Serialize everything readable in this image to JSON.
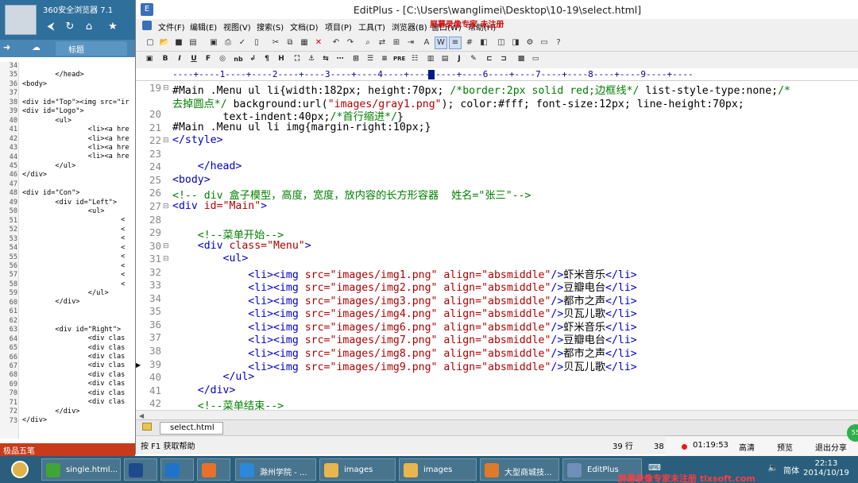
{
  "bg_browser": {
    "title": "360安全浏览器 7.1",
    "tab": "标题",
    "lines": [
      {
        "n": "34",
        "t": ""
      },
      {
        "n": "35",
        "t": "        </head>"
      },
      {
        "n": "36",
        "t": "<body>"
      },
      {
        "n": "37",
        "t": ""
      },
      {
        "n": "38",
        "t": "<div id=\"Top\"><img src=\"ir"
      },
      {
        "n": "39",
        "t": "<div id=\"Logo\">"
      },
      {
        "n": "40",
        "t": "        <ul>"
      },
      {
        "n": "41",
        "t": "                <li><a hre"
      },
      {
        "n": "42",
        "t": "                <li><a hre"
      },
      {
        "n": "43",
        "t": "                <li><a hre"
      },
      {
        "n": "44",
        "t": "                <li><a hre"
      },
      {
        "n": "45",
        "t": "        </ul>"
      },
      {
        "n": "46",
        "t": "</div>"
      },
      {
        "n": "47",
        "t": ""
      },
      {
        "n": "48",
        "t": "<div id=\"Con\">"
      },
      {
        "n": "49",
        "t": "        <div id=\"Left\">"
      },
      {
        "n": "50",
        "t": "                <ul>"
      },
      {
        "n": "51",
        "t": "                        <"
      },
      {
        "n": "52",
        "t": "                        <"
      },
      {
        "n": "53",
        "t": "                        <"
      },
      {
        "n": "54",
        "t": "                        <"
      },
      {
        "n": "55",
        "t": "                        <"
      },
      {
        "n": "56",
        "t": "                        <"
      },
      {
        "n": "57",
        "t": "                        <"
      },
      {
        "n": "58",
        "t": "                        <"
      },
      {
        "n": "59",
        "t": "                </ul>"
      },
      {
        "n": "60",
        "t": "        </div>"
      },
      {
        "n": "61",
        "t": ""
      },
      {
        "n": "62",
        "t": ""
      },
      {
        "n": "63",
        "t": "        <div id=\"Right\">"
      },
      {
        "n": "64",
        "t": "                <div clas"
      },
      {
        "n": "65",
        "t": "                <div clas"
      },
      {
        "n": "66",
        "t": "                <div clas"
      },
      {
        "n": "67",
        "t": "                <div clas"
      },
      {
        "n": "68",
        "t": "                <div clas"
      },
      {
        "n": "69",
        "t": "                <div clas"
      },
      {
        "n": "70",
        "t": "                <div clas"
      },
      {
        "n": "71",
        "t": "                <div clas"
      },
      {
        "n": "72",
        "t": "        </div>"
      },
      {
        "n": "73",
        "t": "</div>"
      }
    ]
  },
  "window": {
    "title": "EditPlus - [C:\\Users\\wanglimei\\Desktop\\10-19\\select.html]",
    "watermark": "屏幕录像专家 未注册"
  },
  "menu": [
    "文件(F)",
    "编辑(E)",
    "视图(V)",
    "搜索(S)",
    "文档(D)",
    "项目(P)",
    "工具(T)",
    "浏览器(B)",
    "窗口(W)",
    "帮助(H)"
  ],
  "ruler": "----+----1----+----2----+----3----+----4----+----5----+----6----+----7----+----8----+----9----+----",
  "editor_lines": [
    {
      "n": "19",
      "fold": "⊟",
      "parts": [
        [
          "sel",
          "#Main .Menu ul li{width:182px; height:70px; "
        ],
        [
          "com",
          "/*border:2px solid red;边框线*/"
        ],
        [
          "sel",
          " list-style-type:none;"
        ],
        [
          "com",
          "/*"
        ]
      ]
    },
    {
      "n": "",
      "fold": "",
      "parts": [
        [
          "com",
          "去掉圆点*/"
        ],
        [
          "sel",
          " background:url("
        ],
        [
          "str",
          "\"images/gray1.png\""
        ],
        [
          "sel",
          "); color:#fff; font-size:12px; line-height:70px;"
        ]
      ]
    },
    {
      "n": "20",
      "fold": "",
      "parts": [
        [
          "sel",
          "        text-indent:40px;"
        ],
        [
          "com",
          "/*首行缩进*/"
        ],
        [
          "sel",
          "}"
        ]
      ]
    },
    {
      "n": "21",
      "fold": "",
      "parts": [
        [
          "sel",
          "#Main .Menu ul li img{margin-right:10px;}"
        ]
      ]
    },
    {
      "n": "22",
      "fold": "⊟",
      "parts": [
        [
          "tag",
          "</style>"
        ]
      ]
    },
    {
      "n": "23",
      "fold": "",
      "parts": [
        [
          "sel",
          ""
        ]
      ]
    },
    {
      "n": "24",
      "fold": "",
      "parts": [
        [
          "tag",
          "    </head>"
        ]
      ]
    },
    {
      "n": "25",
      "fold": "",
      "parts": [
        [
          "tag",
          "<body>"
        ]
      ]
    },
    {
      "n": "26",
      "fold": "",
      "parts": [
        [
          "com",
          "<!-- div 盒子模型，高度，宽度，放内容的长方形容器  姓名=\"张三\"-->"
        ]
      ]
    },
    {
      "n": "27",
      "fold": "⊟",
      "parts": [
        [
          "tag",
          "<div "
        ],
        [
          "attr",
          "id="
        ],
        [
          "str",
          "\"Main\""
        ],
        [
          "tag",
          ">"
        ]
      ]
    },
    {
      "n": "28",
      "fold": "",
      "parts": [
        [
          "sel",
          ""
        ]
      ]
    },
    {
      "n": "29",
      "fold": "",
      "parts": [
        [
          "com",
          "    <!--菜单开始-->"
        ]
      ]
    },
    {
      "n": "30",
      "fold": "⊟",
      "parts": [
        [
          "tag",
          "    <div "
        ],
        [
          "attr",
          "class="
        ],
        [
          "str",
          "\"Menu\""
        ],
        [
          "tag",
          ">"
        ]
      ]
    },
    {
      "n": "31",
      "fold": "⊟",
      "parts": [
        [
          "tag",
          "        <ul>"
        ]
      ]
    },
    {
      "n": "32",
      "fold": "",
      "parts": [
        [
          "tag",
          "            <li><img "
        ],
        [
          "attr",
          "src="
        ],
        [
          "str",
          "\"images/img1.png\""
        ],
        [
          "attr",
          " align="
        ],
        [
          "str",
          "\"absmiddle\""
        ],
        [
          "tag",
          "/>"
        ],
        [
          "sel",
          "虾米音乐"
        ],
        [
          "tag",
          "</li>"
        ]
      ]
    },
    {
      "n": "33",
      "fold": "",
      "parts": [
        [
          "tag",
          "            <li><img "
        ],
        [
          "attr",
          "src="
        ],
        [
          "str",
          "\"images/img2.png\""
        ],
        [
          "attr",
          " align="
        ],
        [
          "str",
          "\"absmiddle\""
        ],
        [
          "tag",
          "/>"
        ],
        [
          "sel",
          "豆瓣电台"
        ],
        [
          "tag",
          "</li>"
        ]
      ]
    },
    {
      "n": "34",
      "fold": "",
      "parts": [
        [
          "tag",
          "            <li><img "
        ],
        [
          "attr",
          "src="
        ],
        [
          "str",
          "\"images/img3.png\""
        ],
        [
          "attr",
          " align="
        ],
        [
          "str",
          "\"absmiddle\""
        ],
        [
          "tag",
          "/>"
        ],
        [
          "sel",
          "都市之声"
        ],
        [
          "tag",
          "</li>"
        ]
      ]
    },
    {
      "n": "35",
      "fold": "",
      "parts": [
        [
          "tag",
          "            <li><img "
        ],
        [
          "attr",
          "src="
        ],
        [
          "str",
          "\"images/img4.png\""
        ],
        [
          "attr",
          " align="
        ],
        [
          "str",
          "\"absmiddle\""
        ],
        [
          "tag",
          "/>"
        ],
        [
          "sel",
          "贝瓦儿歌"
        ],
        [
          "tag",
          "</li>"
        ]
      ]
    },
    {
      "n": "36",
      "fold": "",
      "parts": [
        [
          "tag",
          "            <li><img "
        ],
        [
          "attr",
          "src="
        ],
        [
          "str",
          "\"images/img6.png\""
        ],
        [
          "attr",
          " align="
        ],
        [
          "str",
          "\"absmiddle\""
        ],
        [
          "tag",
          "/>"
        ],
        [
          "sel",
          "虾米音乐"
        ],
        [
          "tag",
          "</li>"
        ]
      ]
    },
    {
      "n": "37",
      "fold": "",
      "parts": [
        [
          "tag",
          "            <li><img "
        ],
        [
          "attr",
          "src="
        ],
        [
          "str",
          "\"images/img7.png\""
        ],
        [
          "attr",
          " align="
        ],
        [
          "str",
          "\"absmiddle\""
        ],
        [
          "tag",
          "/>"
        ],
        [
          "sel",
          "豆瓣电台"
        ],
        [
          "tag",
          "</li>"
        ]
      ]
    },
    {
      "n": "38",
      "fold": "",
      "parts": [
        [
          "tag",
          "            <li><img "
        ],
        [
          "attr",
          "src="
        ],
        [
          "str",
          "\"images/img8.png\""
        ],
        [
          "attr",
          " align="
        ],
        [
          "str",
          "\"absmiddle\""
        ],
        [
          "tag",
          "/>"
        ],
        [
          "sel",
          "都市之声"
        ],
        [
          "tag",
          "</li>"
        ]
      ]
    },
    {
      "n": "39",
      "fold": "",
      "parts": [
        [
          "tag",
          "            <li><img "
        ],
        [
          "attr",
          "src="
        ],
        [
          "str",
          "\"images/img9.png\""
        ],
        [
          "attr",
          " align="
        ],
        [
          "str",
          "\"absmiddle\""
        ],
        [
          "tag",
          "/>"
        ],
        [
          "sel",
          "贝瓦儿歌"
        ],
        [
          "tag",
          "</li>"
        ]
      ]
    },
    {
      "n": "40",
      "fold": "",
      "parts": [
        [
          "tag",
          "        </ul>"
        ]
      ]
    },
    {
      "n": "41",
      "fold": "",
      "parts": [
        [
          "tag",
          "    </div>"
        ]
      ]
    },
    {
      "n": "42",
      "fold": "",
      "parts": [
        [
          "com",
          "    <!--菜单结束-->"
        ]
      ]
    }
  ],
  "doc_tab": "select.html",
  "status": {
    "help": "按 F1 获取帮助",
    "line": "39 行",
    "col": "38 列"
  },
  "recorder": {
    "time": "01:19:53",
    "hd": "高清",
    "preview": "预览",
    "exit_share": "退出分享",
    "green": "55"
  },
  "ime": "极品五笔",
  "taskbar": [
    {
      "label": "single.html...",
      "color": "#3fa635"
    },
    {
      "label": "",
      "color": "#1d4a8c"
    },
    {
      "label": "",
      "color": "#1f74c9"
    },
    {
      "label": "",
      "color": "#e8702a"
    },
    {
      "label": "滁州学院 - ...",
      "color": "#2c88d8"
    },
    {
      "label": "images",
      "color": "#e8b64c"
    },
    {
      "label": "images",
      "color": "#e8b64c"
    },
    {
      "label": "大型商城技...",
      "color": "#e07a2a"
    },
    {
      "label": "EditPlus",
      "color": "#6f8fb8"
    }
  ],
  "tray_lang": "简体",
  "clock": {
    "time": "22:13",
    "date": "2014/10/19"
  },
  "watermark_bottom": "屏幕录像专家未注册 tlxsoft.com"
}
